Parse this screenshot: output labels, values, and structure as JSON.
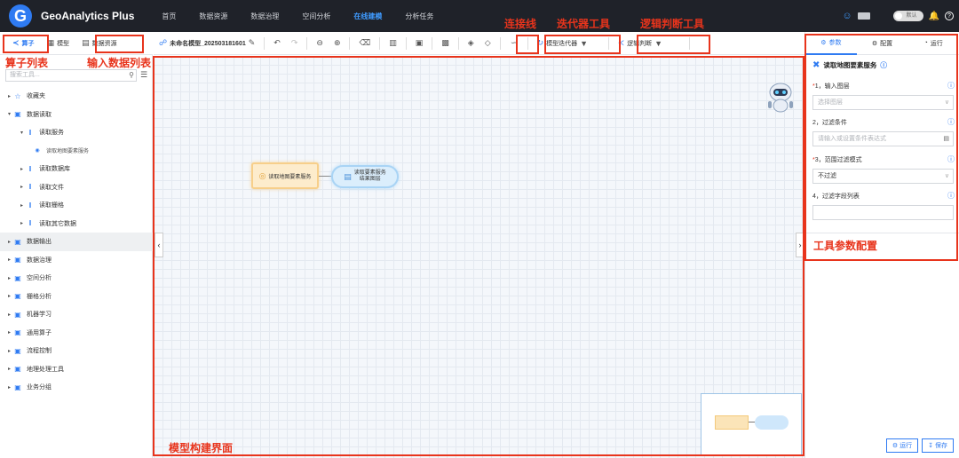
{
  "app": {
    "logo_letter": "G",
    "name": "GeoAnalytics Plus"
  },
  "nav": [
    "首页",
    "数据资源",
    "数据治理",
    "空间分析",
    "在线建模",
    "分析任务"
  ],
  "header_right": {
    "toggle_label": "默认"
  },
  "left_tabs": [
    {
      "icon": "operator-icon",
      "label": "算子"
    },
    {
      "icon": "model-icon",
      "label": "模型"
    },
    {
      "icon": "data-resource-icon",
      "label": "数据资源"
    }
  ],
  "toolbar": {
    "model_name": "未命名模型_202503181601",
    "iterator_label": "模型迭代器",
    "logic_label": "逻辑判断"
  },
  "search": {
    "placeholder": "搜索工具..."
  },
  "tree": [
    {
      "label": "收藏夹",
      "icon": "star-icon"
    },
    {
      "label": "数据读取",
      "icon": "toolbox-icon"
    },
    {
      "label": "读取服务",
      "icon": "library-icon"
    },
    {
      "label": "读取地图要素服务",
      "icon": "bullet-icon"
    },
    {
      "label": "读取数据库",
      "icon": "library-icon"
    },
    {
      "label": "读取文件",
      "icon": "library-icon"
    },
    {
      "label": "读取栅格",
      "icon": "library-icon"
    },
    {
      "label": "读取其它数据",
      "icon": "library-icon"
    },
    {
      "label": "数据输出",
      "icon": "toolbox-icon"
    },
    {
      "label": "数据治理",
      "icon": "toolbox-icon"
    },
    {
      "label": "空间分析",
      "icon": "toolbox-icon"
    },
    {
      "label": "栅格分析",
      "icon": "toolbox-icon"
    },
    {
      "label": "机器学习",
      "icon": "toolbox-icon"
    },
    {
      "label": "通用算子",
      "icon": "toolbox-icon"
    },
    {
      "label": "流程控制",
      "icon": "toolbox-icon"
    },
    {
      "label": "地理处理工具",
      "icon": "toolbox-icon"
    },
    {
      "label": "业务分组",
      "icon": "toolbox-icon"
    }
  ],
  "canvas": {
    "node1_label": "读取地图要素服务",
    "node2_line1": "读取要素服务",
    "node2_line2": "结果图层"
  },
  "right_panel": {
    "tabs": [
      "参数",
      "配置",
      "运行"
    ],
    "title": "读取地图要素服务",
    "fields": [
      {
        "label": "1，输入图层",
        "required": true,
        "placeholder": "选择图层"
      },
      {
        "label": "2，过滤条件",
        "required": false,
        "placeholder": "请输入或设置条件表达式"
      },
      {
        "label": "3，范围过滤模式",
        "required": true,
        "value": "不过滤"
      },
      {
        "label": "4，过滤字段列表",
        "required": false,
        "value": ""
      }
    ],
    "run_button": "运行",
    "save_button": "保存"
  },
  "annotations": {
    "operator_list": "算子列表",
    "input_data_list": "输入数据列表",
    "connector": "连接线",
    "iterator_tool": "迭代器工具",
    "logic_tool": "逻辑判断工具",
    "tool_params": "工具参数配置",
    "model_canvas": "模型构建界面"
  },
  "colors": {
    "accent": "#2f7bf2",
    "annotation": "#e8341c",
    "header_bg": "#1f2229"
  }
}
